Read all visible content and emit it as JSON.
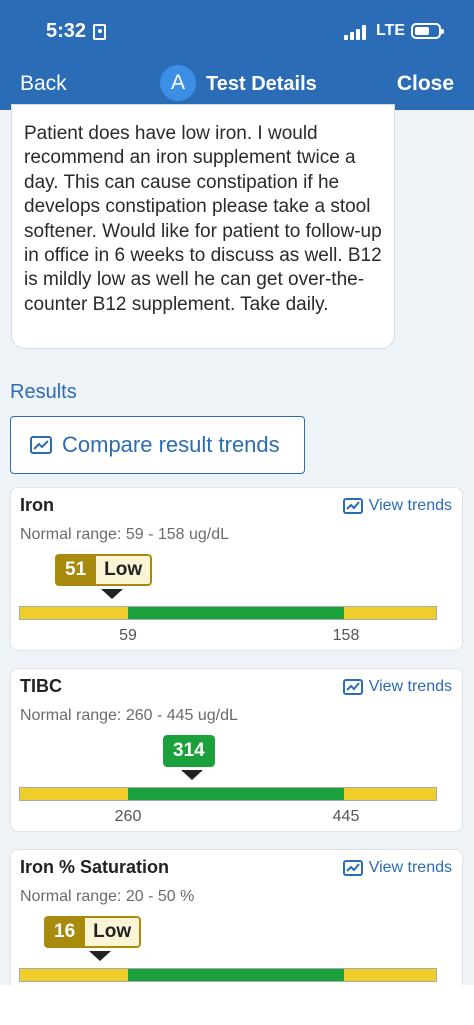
{
  "status_bar": {
    "time": "5:32",
    "network": "LTE"
  },
  "nav": {
    "back": "Back",
    "avatar": "A",
    "title": "Test Details",
    "close": "Close"
  },
  "note": {
    "text": "Patient does have low iron. I would recommend an iron supplement twice a day. This can cause constipation if he develops constipation please take a stool softener. Would like for patient to follow-up in office in 6 weeks to discuss as well. B12 is mildly low as well he can get over-the-counter B12 supplement. Take daily."
  },
  "results": {
    "heading": "Results",
    "compare_label": "Compare result trends",
    "view_trends_label": "View trends",
    "items": [
      {
        "name": "Iron",
        "range": "Normal range: 59 - 158 ug/dL",
        "value": "51",
        "flag": "Low",
        "low": "59",
        "high": "158"
      },
      {
        "name": "TIBC",
        "range": "Normal range: 260 - 445 ug/dL",
        "value": "314",
        "flag": "",
        "low": "260",
        "high": "445"
      },
      {
        "name": "Iron % Saturation",
        "range": "Normal range: 20 - 50 %",
        "value": "16",
        "flag": "Low",
        "low": "",
        "high": ""
      }
    ]
  },
  "colors": {
    "brand": "#2b6cb6",
    "low": "#a88a0c",
    "normal": "#1aa13b",
    "out_of_range": "#efcd2a"
  }
}
